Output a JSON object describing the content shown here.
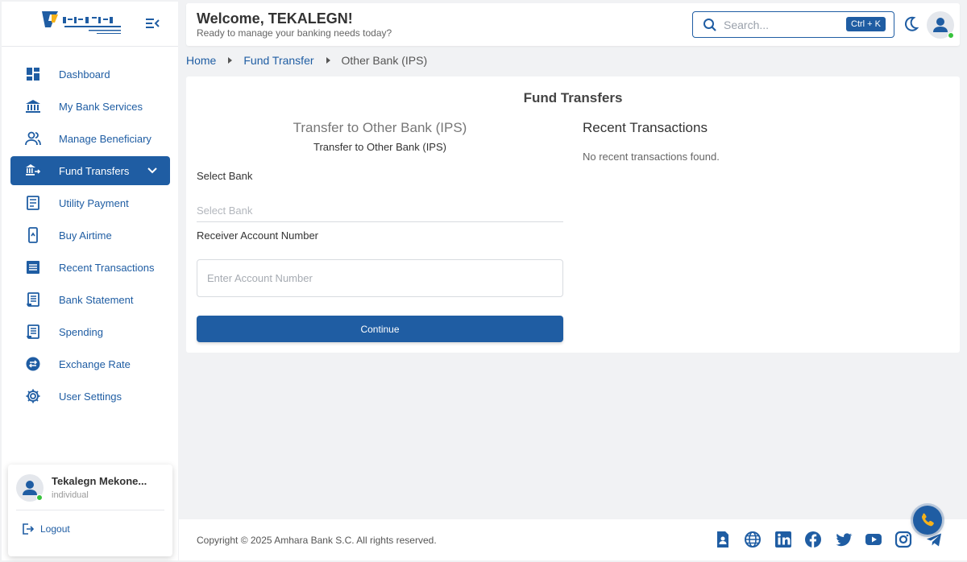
{
  "brand": {
    "primary": "#1f5da3",
    "accent": "#f5b21b",
    "online": "#37c23c"
  },
  "sidebar": {
    "logo_icon": "amhara-bank-logo",
    "items": [
      {
        "label": "Dashboard",
        "icon": "dashboard-icon"
      },
      {
        "label": "My Bank Services",
        "icon": "bank-icon"
      },
      {
        "label": "Manage Beneficiary",
        "icon": "people-icon"
      },
      {
        "label": "Fund Transfers",
        "icon": "transfer-icon",
        "active": true
      },
      {
        "label": "Utility Payment",
        "icon": "receipt-icon"
      },
      {
        "label": "Buy Airtime",
        "icon": "phone-icon"
      },
      {
        "label": "Recent Transactions",
        "icon": "list-icon"
      },
      {
        "label": "Bank Statement",
        "icon": "statement-icon"
      },
      {
        "label": "Spending",
        "icon": "spending-icon"
      },
      {
        "label": "Exchange Rate",
        "icon": "exchange-icon"
      },
      {
        "label": "User Settings",
        "icon": "gear-icon"
      }
    ],
    "user": {
      "name": "Tekalegn Mekone...",
      "role": "individual",
      "logout_label": "Logout"
    }
  },
  "header": {
    "welcome": "Welcome, TEKALEGN!",
    "subtitle": "Ready to manage your banking needs today?",
    "search_placeholder": "Search...",
    "search_shortcut": "Ctrl + K"
  },
  "breadcrumb": {
    "home": "Home",
    "section": "Fund Transfer",
    "current": "Other Bank (IPS)"
  },
  "main": {
    "card_title": "Fund Transfers",
    "form_title": "Transfer to Other Bank (IPS)",
    "form_subtitle": "Transfer to Other Bank (IPS)",
    "select_bank_label": "Select Bank",
    "select_bank_placeholder": "Select Bank",
    "account_label": "Receiver Account Number",
    "account_placeholder": "Enter Account Number",
    "continue_label": "Continue",
    "recent_title": "Recent Transactions",
    "recent_empty": "No recent transactions found."
  },
  "footer": {
    "copyright": "Copyright © 2025 Amhara Bank S.C. All rights reserved.",
    "social_icons": [
      "contact-card-icon",
      "globe-icon",
      "linkedin-icon",
      "facebook-icon",
      "twitter-icon",
      "youtube-icon",
      "instagram-icon",
      "telegram-icon"
    ]
  }
}
